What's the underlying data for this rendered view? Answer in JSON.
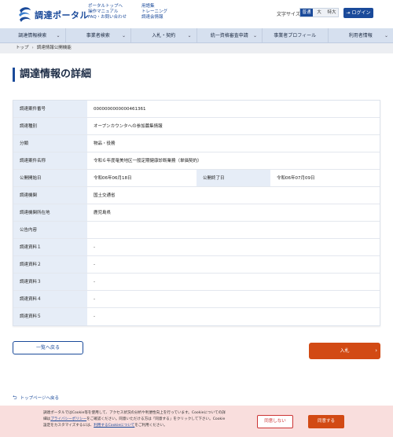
{
  "header": {
    "logo_text": "調達ポータル",
    "links_col1": [
      "ポータルトップへ",
      "操作マニュアル",
      "FAQ・お問い合わせ"
    ],
    "links_col2": [
      "用語集",
      "トレーニング",
      "調達会情報"
    ],
    "font_size_label": "文字サイズ",
    "font_sizes": [
      "普通",
      "大",
      "特大"
    ],
    "font_size_selected": "普通",
    "login_label": "ログイン"
  },
  "nav": {
    "items": [
      "調達情報検索",
      "事業者検索",
      "入札・契約",
      "統一資格審査申請",
      "事業者プロフィール",
      "利用者情報"
    ]
  },
  "breadcrumb": {
    "home": "トップ",
    "current": "調達情報公開機能"
  },
  "page_title": "調達情報の詳細",
  "details": {
    "rows": [
      {
        "label": "調達案件番号",
        "value": "0000000000000461361"
      },
      {
        "label": "調達種別",
        "value": "オープンカウンタへの参加募集情報"
      },
      {
        "label": "分類",
        "value": "物品・役務"
      },
      {
        "label": "調達案件名称",
        "value": "令和６年度奄美地区一般定期健康診断業務（単価契約）"
      }
    ],
    "start_label": "公開開始日",
    "start_value": "令和06年06月18日",
    "end_label": "公開終了日",
    "end_value": "令和06年07月09日",
    "rows2": [
      {
        "label": "調達機関",
        "value": "国土交通省"
      },
      {
        "label": "調達機関所在地",
        "value": "鹿児島県"
      },
      {
        "label": "公告内容",
        "value": ""
      },
      {
        "label": "調達資料１",
        "value": "-"
      },
      {
        "label": "調達資料２",
        "value": "-"
      },
      {
        "label": "調達資料３",
        "value": "-"
      },
      {
        "label": "調達資料４",
        "value": "-"
      },
      {
        "label": "調達資料５",
        "value": "-"
      }
    ]
  },
  "buttons": {
    "back": "一覧へ戻る",
    "bid": "入札"
  },
  "to_top": "トップページへ戻る",
  "cookie": {
    "text_1": "調達ポータルではCookie等を使用して、アクセス状況の分析や利便性向上を行っています。Cookieについての詳",
    "text_2a": "細は",
    "privacy_link": "プライバシーポリシー",
    "text_2b": "をご確認ください。同意いただける方は「同意する」をクリックして下さい。Cookie",
    "text_3a": "設定をカスタマイズするには、",
    "customize_link": "利用するCookieについて",
    "text_3b": "をご利用ください。",
    "deny": "同意しない",
    "accept": "同意する"
  },
  "colors": {
    "brand": "#1a4a9a",
    "accent": "#d24a14",
    "nav_bg": "#d6e0ef",
    "cookie_bg": "#f9dedd"
  }
}
